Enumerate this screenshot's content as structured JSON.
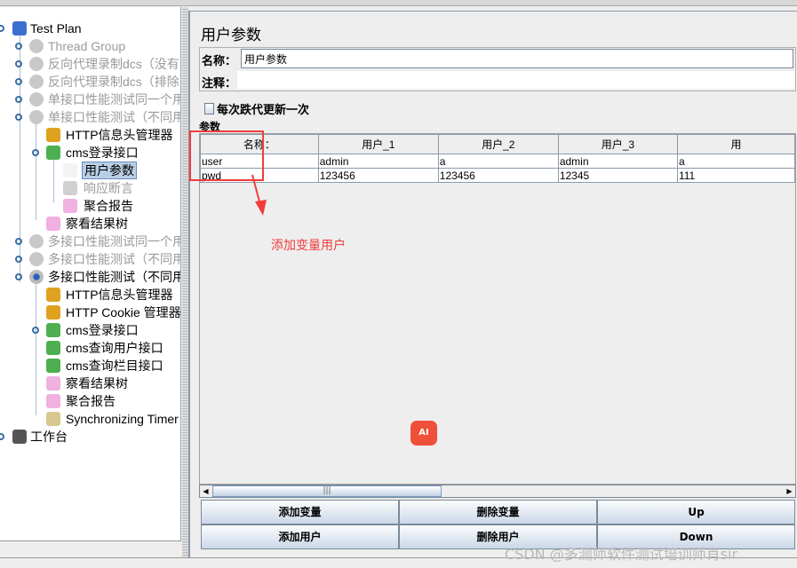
{
  "tree": {
    "items": [
      {
        "label": "Test Plan",
        "level": 0,
        "icon": "flask-icon",
        "state": "normal"
      },
      {
        "label": "Thread Group",
        "level": 1,
        "icon": "gear-icon",
        "state": "disabled"
      },
      {
        "label": "反向代理录制dcs（没有",
        "level": 1,
        "icon": "gear-icon",
        "state": "disabled"
      },
      {
        "label": "反向代理录制dcs（排除",
        "level": 1,
        "icon": "gear-icon",
        "state": "disabled"
      },
      {
        "label": "单接口性能测试同一个用",
        "level": 1,
        "icon": "gear-icon",
        "state": "disabled"
      },
      {
        "label": "单接口性能测试（不同用",
        "level": 1,
        "icon": "gear-icon",
        "state": "disabled"
      },
      {
        "label": "HTTP信息头管理器",
        "level": 2,
        "icon": "wrench-icon",
        "state": "normal"
      },
      {
        "label": "cms登录接口",
        "level": 2,
        "icon": "pipette-icon",
        "state": "normal"
      },
      {
        "label": "用户参数",
        "level": 3,
        "icon": "user-params-icon",
        "state": "selected"
      },
      {
        "label": "响应断言",
        "level": 3,
        "icon": "magnifier-icon",
        "state": "disabled"
      },
      {
        "label": "聚合报告",
        "level": 3,
        "icon": "graph-icon",
        "state": "normal"
      },
      {
        "label": "察看结果树",
        "level": 2,
        "icon": "graph-icon",
        "state": "normal"
      },
      {
        "label": "多接口性能测试同一个用",
        "level": 1,
        "icon": "gear-icon",
        "state": "disabled"
      },
      {
        "label": "多接口性能测试（不同用",
        "level": 1,
        "icon": "gear-icon",
        "state": "disabled"
      },
      {
        "label": "多接口性能测试（不同用",
        "level": 1,
        "icon": "gear-icon",
        "state": "normal"
      },
      {
        "label": "HTTP信息头管理器",
        "level": 2,
        "icon": "wrench-icon",
        "state": "normal"
      },
      {
        "label": "HTTP Cookie 管理器",
        "level": 2,
        "icon": "wrench-icon",
        "state": "normal"
      },
      {
        "label": "cms登录接口",
        "level": 2,
        "icon": "pipette-icon",
        "state": "normal"
      },
      {
        "label": "cms查询用户接口",
        "level": 2,
        "icon": "pipette-icon",
        "state": "normal"
      },
      {
        "label": "cms查询栏目接口",
        "level": 2,
        "icon": "pipette-icon",
        "state": "normal"
      },
      {
        "label": "察看结果树",
        "level": 2,
        "icon": "graph-icon",
        "state": "normal"
      },
      {
        "label": "聚合报告",
        "level": 2,
        "icon": "graph-icon",
        "state": "normal"
      },
      {
        "label": "Synchronizing Timer",
        "level": 2,
        "icon": "timer-icon",
        "state": "normal"
      },
      {
        "label": "工作台",
        "level": 0,
        "icon": "workbench-icon",
        "state": "normal"
      }
    ]
  },
  "panel": {
    "title": "用户参数",
    "name_label": "名称：",
    "name_value": "用户参数",
    "comment_label": "注释：",
    "comment_value": "",
    "checkbox_label": "每次跌代更新一次",
    "checkbox_checked": false,
    "params_label": "参数"
  },
  "table": {
    "headers": [
      "名称：",
      "用户_1",
      "用户_2",
      "用户_3",
      "用"
    ],
    "rows": [
      [
        "user",
        "admin",
        "a",
        "admin",
        "a"
      ],
      [
        "pwd",
        "123456",
        "123456",
        "12345",
        "111"
      ]
    ]
  },
  "buttons": {
    "add_var": "添加变量",
    "del_var": "删除变量",
    "up": "Up",
    "add_user": "添加用户",
    "del_user": "删除用户",
    "down": "Down"
  },
  "annotation": {
    "text": "添加变量用户",
    "color": "#f23c3c"
  },
  "ai_badge": "AI",
  "watermark": "CSDN @多测师软件测试培训师肖sir"
}
